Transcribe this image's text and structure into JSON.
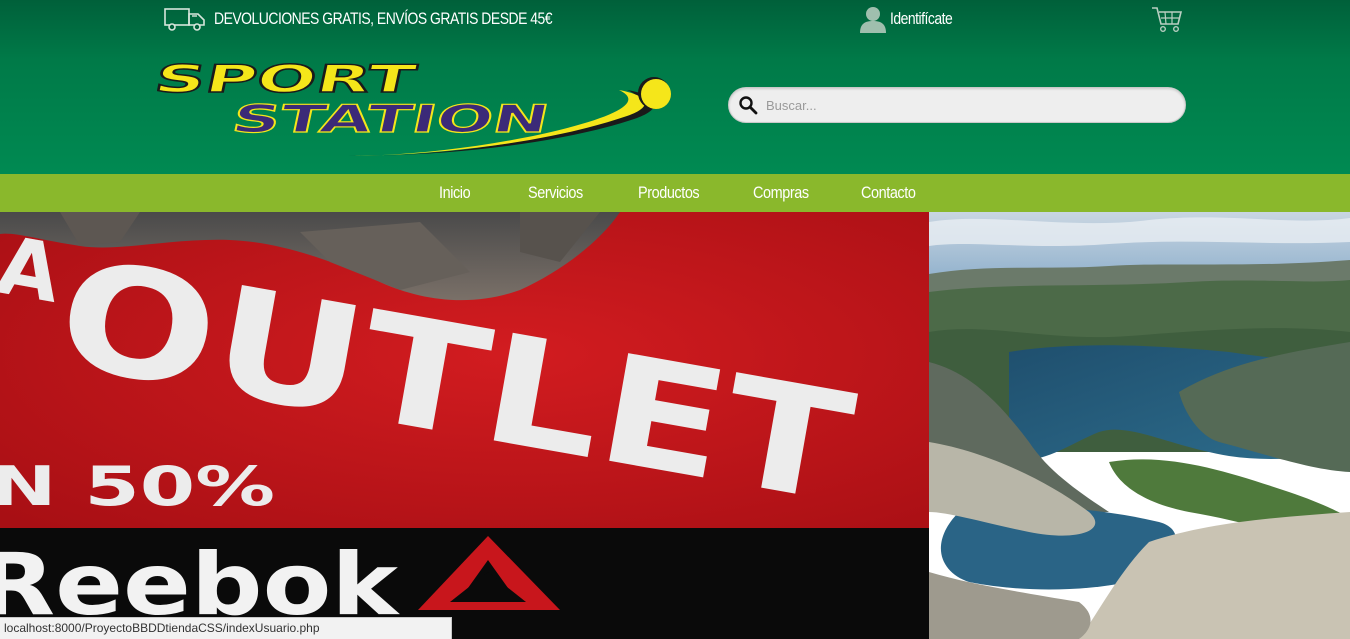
{
  "topbar": {
    "shipping_text": "DEVOLUCIONES GRATIS, ENVÍOS GRATIS DESDE 45€",
    "login_label": "Identifícate"
  },
  "logo": {
    "line1": "SPORT",
    "line2": "STATION"
  },
  "search": {
    "placeholder": "Buscar..."
  },
  "nav": {
    "items": [
      {
        "label": "Inicio"
      },
      {
        "label": "Servicios"
      },
      {
        "label": "Productos"
      },
      {
        "label": "Compras"
      },
      {
        "label": "Contacto"
      }
    ]
  },
  "banner": {
    "outlet_text": "OUTLET",
    "discount_text": "N 50%",
    "discount_prefix": "A",
    "brand_text": "Reebok"
  },
  "status_bar": {
    "url": "localhost:8000/ProyectoBBDDtiendaCSS/indexUsuario.php"
  },
  "colors": {
    "header_green": "#00703f",
    "nav_green": "#8ab82c",
    "logo_yellow": "#f5e61a",
    "logo_purple": "#3b2a78",
    "banner_red": "#c0161c"
  }
}
